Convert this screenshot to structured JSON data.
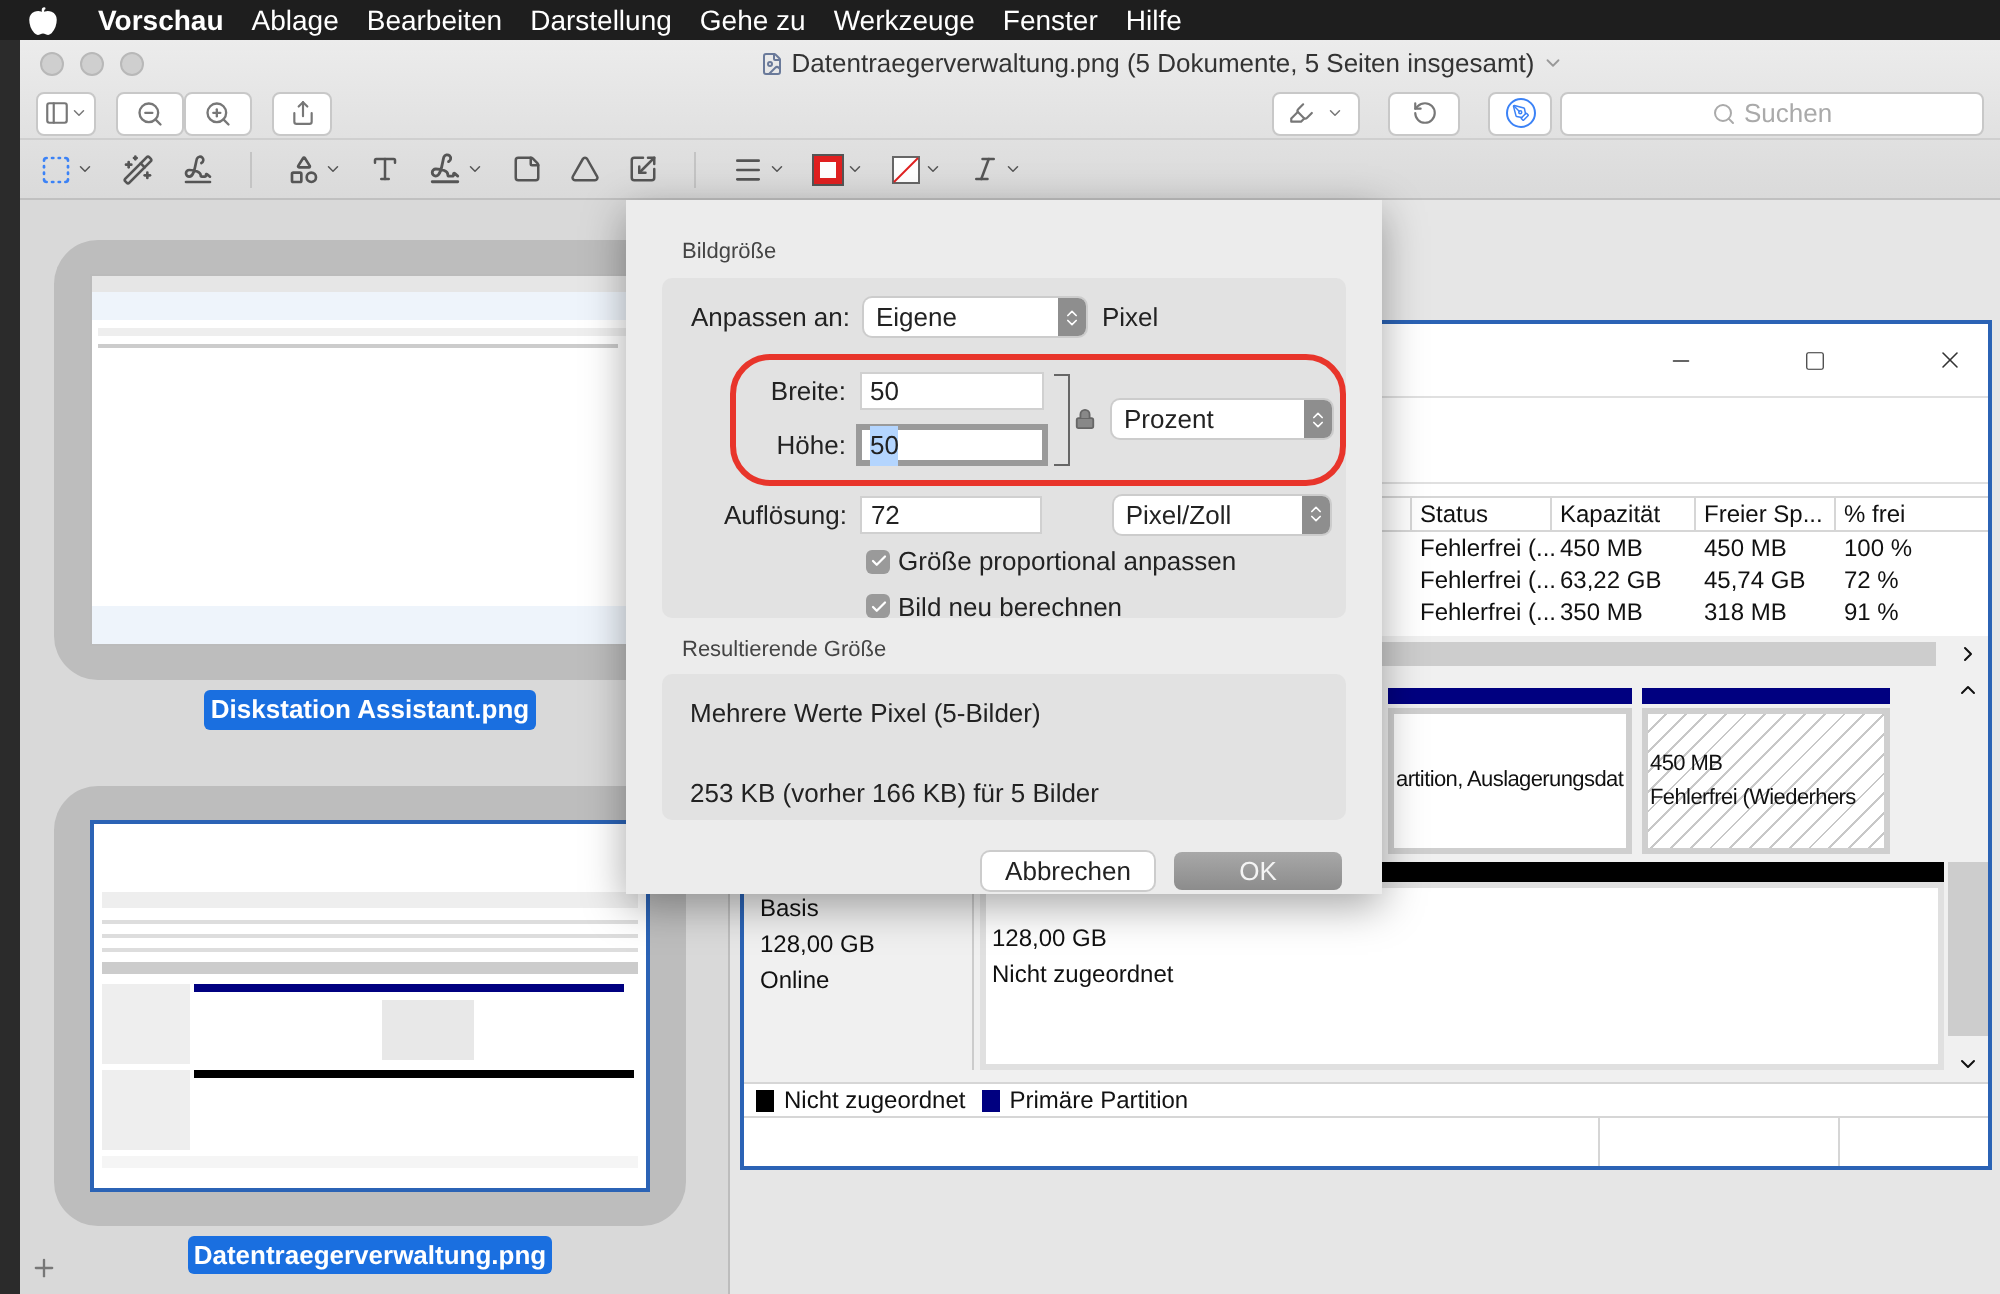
{
  "menu_bar": {
    "app": "Vorschau",
    "items": [
      "Ablage",
      "Bearbeiten",
      "Darstellung",
      "Gehe zu",
      "Werkzeuge",
      "Fenster",
      "Hilfe"
    ]
  },
  "window": {
    "title": "Datentraegerverwaltung.png (5 Dokumente, 5 Seiten insgesamt)",
    "search": {
      "placeholder": "Suchen"
    }
  },
  "sidebar": {
    "items": [
      {
        "label": "Diskstation Assistant.png",
        "selected": true,
        "kind": "assistant"
      },
      {
        "label": "Datentraegerverwaltung.png",
        "selected": true,
        "kind": "disk"
      }
    ]
  },
  "document": {
    "table": {
      "columns": [
        "Status",
        "Kapazität",
        "Freier Sp...",
        "% frei"
      ],
      "rows": [
        [
          "Fehlerfrei (...",
          "450 MB",
          "450 MB",
          "100 %"
        ],
        [
          "Fehlerfrei (...",
          "63,22 GB",
          "45,74 GB",
          "72 %"
        ],
        [
          "Fehlerfrei (...",
          "350 MB",
          "318 MB",
          "91 %"
        ]
      ]
    },
    "disk0_partitions": [
      {
        "kind": "primary",
        "lines": [
          "artition, Auslagerungsdat"
        ]
      },
      {
        "kind": "hatched",
        "lines": [
          "450 MB",
          "Fehlerfrei (Wiederhers"
        ]
      }
    ],
    "disk1": {
      "info": [
        "Basis",
        "128,00 GB",
        "Online"
      ],
      "partition_lines": [
        "128,00 GB",
        "Nicht zugeordnet"
      ]
    },
    "legend": [
      {
        "label": "Nicht zugeordnet",
        "color": "#000000"
      },
      {
        "label": "Primäre Partition",
        "color": "#000080"
      }
    ]
  },
  "dialog": {
    "section_title": "Bildgröße",
    "fit_label": "Anpassen an:",
    "fit_value": "Eigene",
    "fit_unit": "Pixel",
    "width_label": "Breite:",
    "width_value": "50",
    "height_label": "Höhe:",
    "height_value": "50",
    "height_focused": true,
    "size_unit": "Prozent",
    "highlighted": true,
    "resolution_label": "Auflösung:",
    "resolution_value": "72",
    "resolution_unit": "Pixel/Zoll",
    "checkboxes": [
      {
        "label": "Größe proportional anpassen",
        "checked": true
      },
      {
        "label": "Bild neu berechnen",
        "checked": true
      }
    ],
    "result_title": "Resultierende Größe",
    "result_lines": [
      "Mehrere Werte Pixel (5-Bilder)",
      "253 KB (vorher 166 KB) für 5 Bilder"
    ],
    "buttons": [
      {
        "label": "Abbrechen",
        "kind": "secondary"
      },
      {
        "label": "OK",
        "kind": "default"
      }
    ]
  }
}
